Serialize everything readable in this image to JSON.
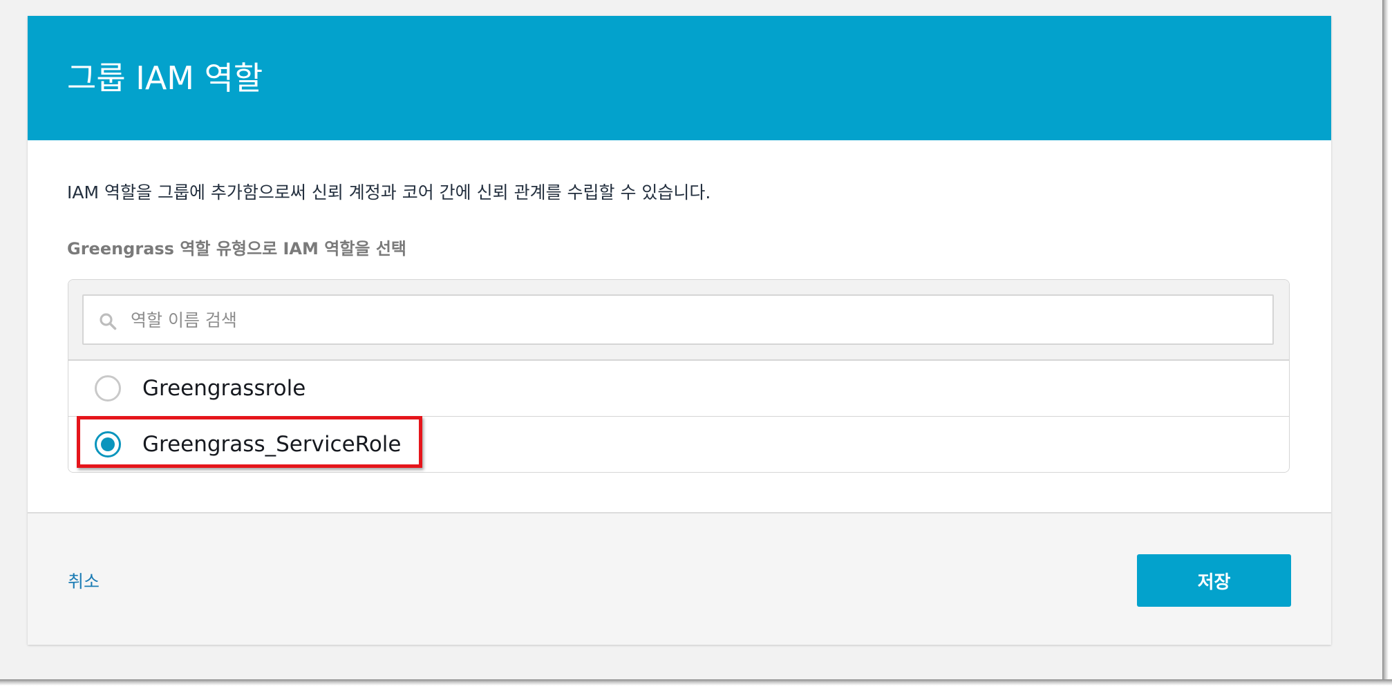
{
  "dialog": {
    "title": "그룹 IAM 역할",
    "description": "IAM 역할을 그룹에 추가함으로써 신뢰 계정과 코어 간에 신뢰 관계를 수립할 수 있습니다.",
    "section_label": "Greengrass 역할 유형으로 IAM 역할을 선택"
  },
  "search": {
    "placeholder": "역할 이름 검색",
    "value": ""
  },
  "roles": [
    {
      "name": "Greengrassrole",
      "selected": false
    },
    {
      "name": "Greengrass_ServiceRole",
      "selected": true
    }
  ],
  "footer": {
    "cancel_label": "취소",
    "save_label": "저장"
  },
  "icons": {
    "search": "search-icon",
    "radio": "radio-button"
  },
  "colors": {
    "header_background": "#03a2cc",
    "primary_button": "#03a2cc",
    "radio_selected": "#0a95bd",
    "link": "#1a7bb4",
    "annotation_highlight": "#e5151b"
  }
}
